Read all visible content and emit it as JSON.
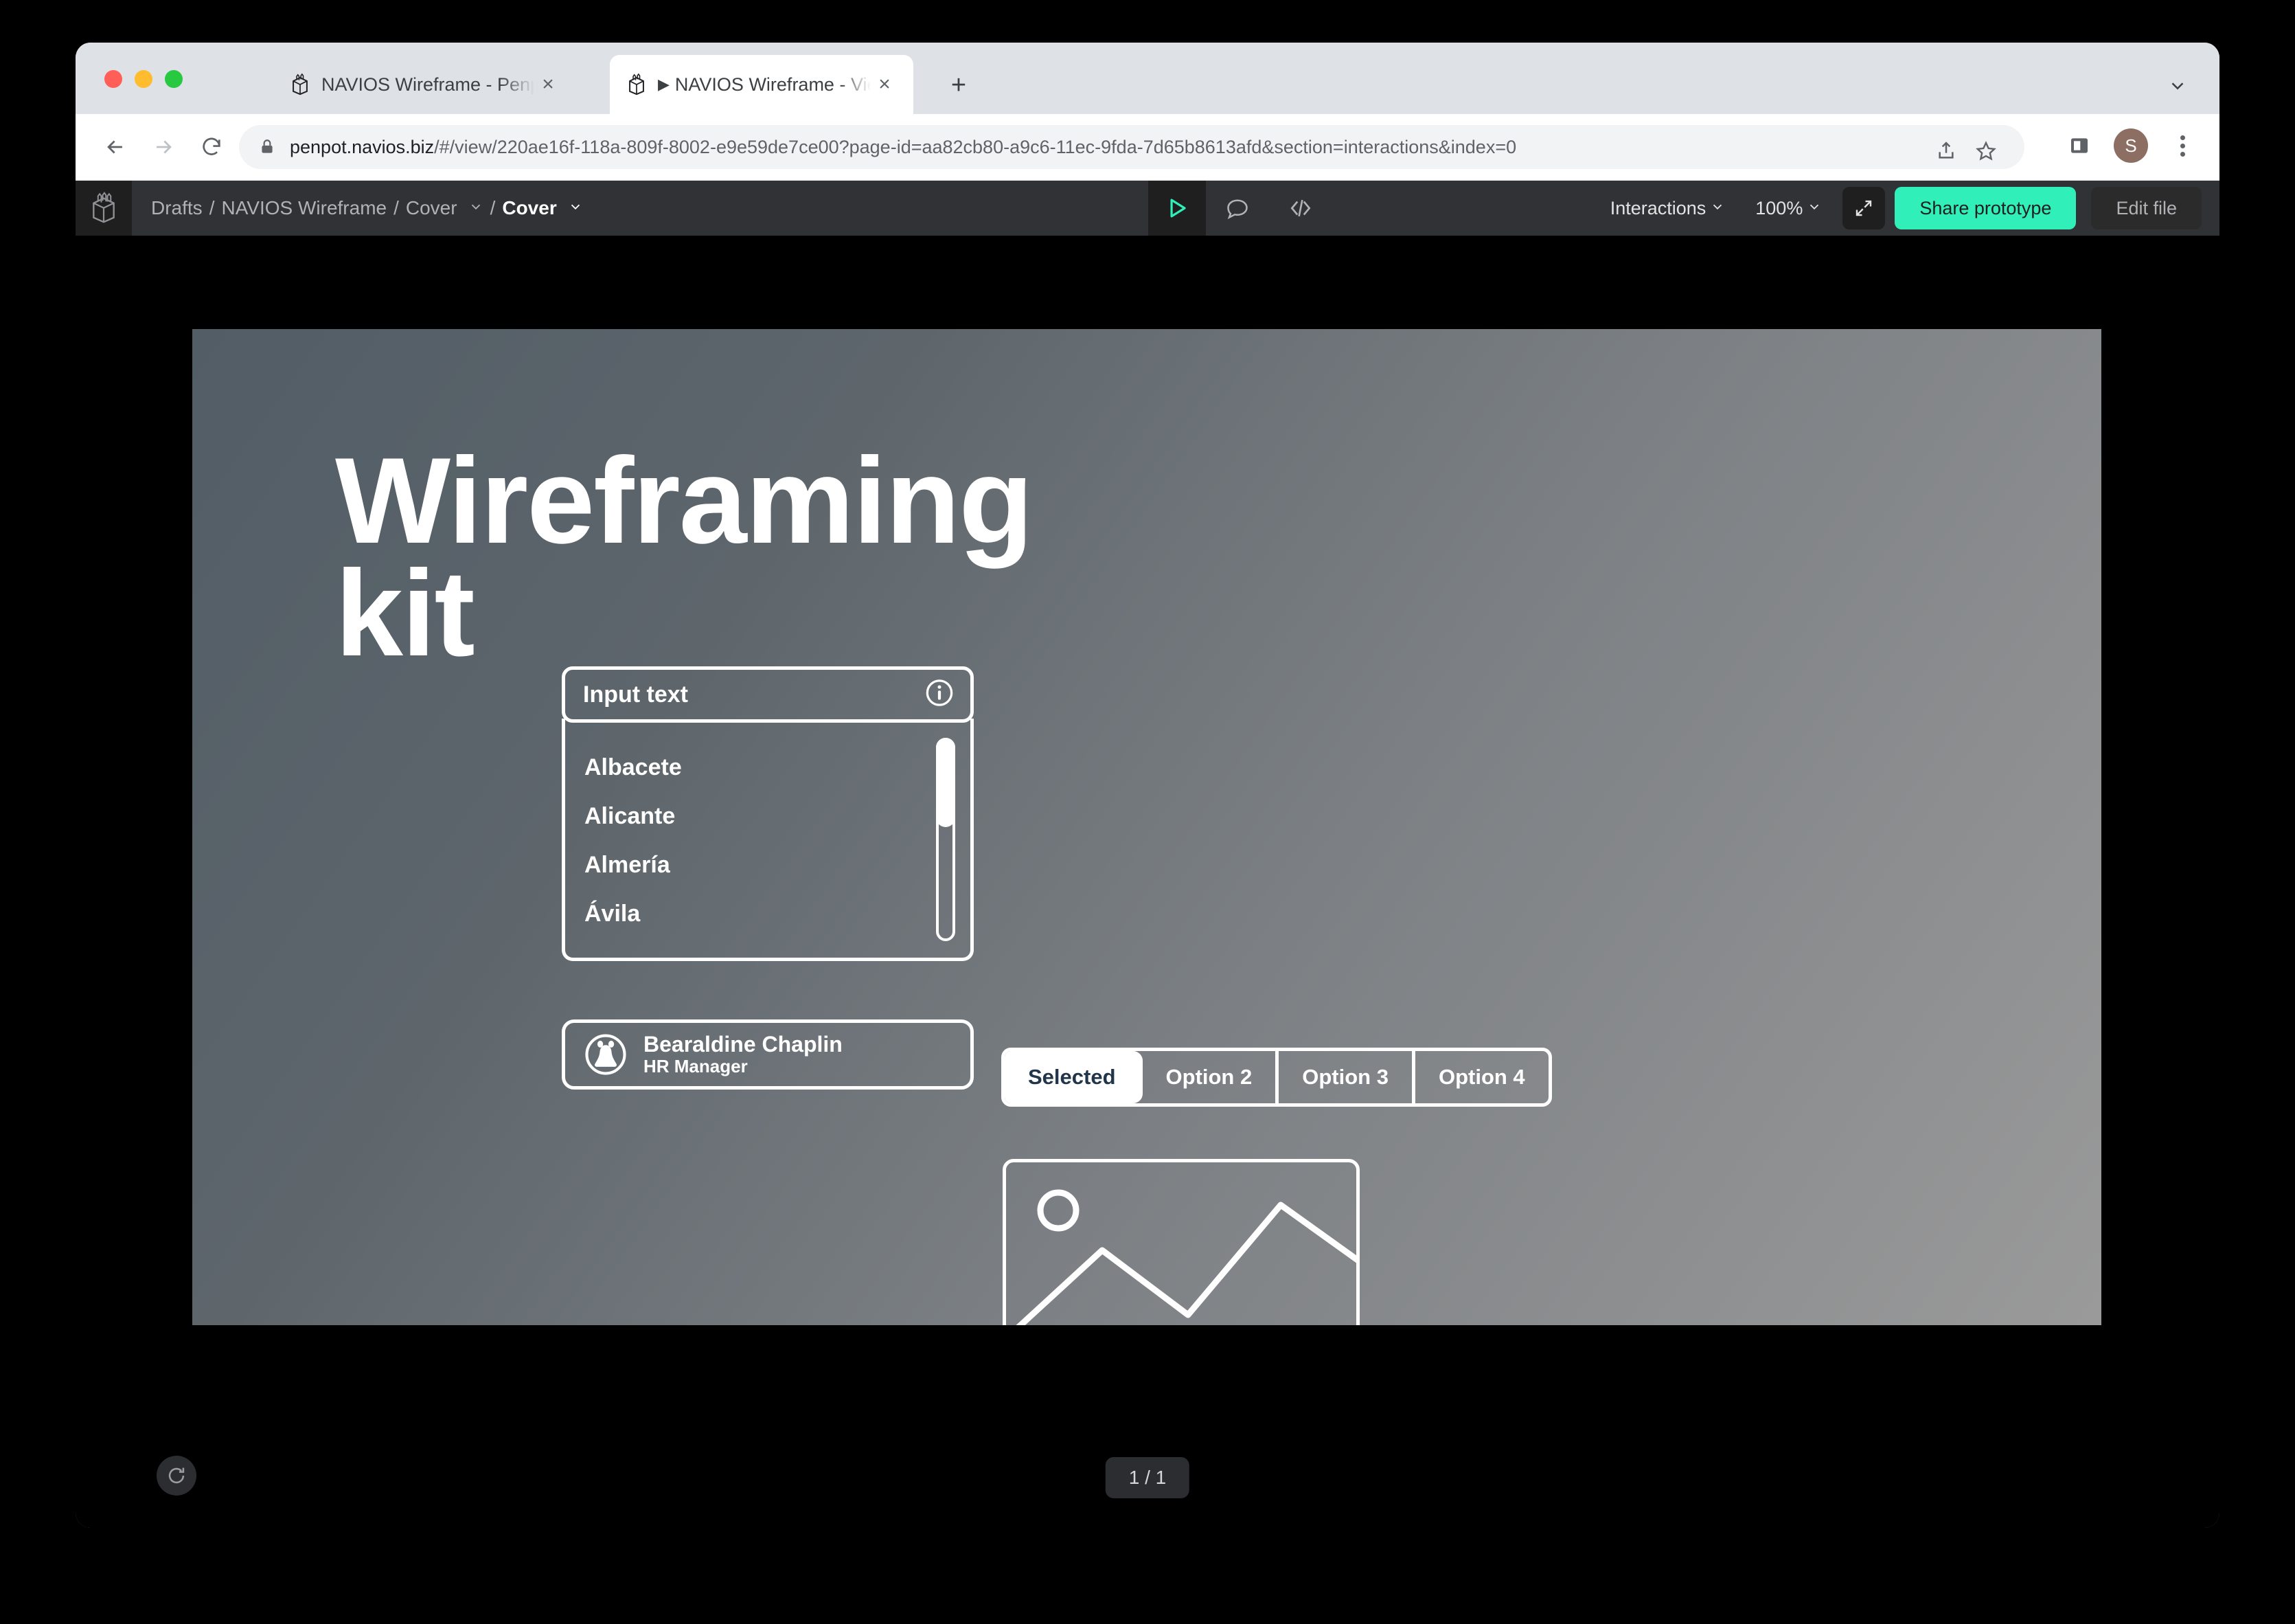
{
  "browser": {
    "tabs": [
      {
        "title": "NAVIOS Wireframe - Penpot",
        "active": false
      },
      {
        "title": "NAVIOS Wireframe - View mo",
        "active": true
      }
    ],
    "new_tab_label": "+",
    "close_label": "×",
    "tab_play_glyph": "▶",
    "url_host": "penpot.navios.biz",
    "url_path": "/#/view/220ae16f-118a-809f-8002-e9e59de7ce00?page-id=aa82cb80-a9c6-11ec-9fda-7d65b8613afd&section=interactions&index=0",
    "profile_initial": "S",
    "icons": {
      "back": "back-arrow-icon",
      "forward": "forward-arrow-icon",
      "reload": "reload-icon",
      "lock": "lock-icon",
      "share": "share-icon",
      "bookmark": "star-icon",
      "sidepanel": "side-panel-icon",
      "menu": "kebab-menu-icon",
      "tabstrip_menu": "chevron-down-icon"
    }
  },
  "penpot": {
    "breadcrumb": {
      "drafts": "Drafts",
      "sep": "/",
      "file": "NAVIOS Wireframe",
      "page": "Cover",
      "board": "Cover"
    },
    "header_icons": {
      "play": "play-icon",
      "comments": "comment-icon",
      "code": "code-icon",
      "fullscreen": "fullscreen-icon"
    },
    "interactions_label": "Interactions",
    "zoom_label": "100%",
    "share_label": "Share prototype",
    "edit_label": "Edit file",
    "page_indicator": "1 / 1",
    "reset_icon": "reset-icon",
    "colors": {
      "accent": "#31efb8",
      "header_bg": "#303236",
      "panel_bg": "#1f1f1f"
    }
  },
  "artboard": {
    "headline_line1": "Wireframing",
    "headline_line2": "kit",
    "dropdown": {
      "input_label": "Input text",
      "info_icon": "info-icon",
      "items": [
        "Albacete",
        "Alicante",
        "Almería",
        "Ávila"
      ]
    },
    "person": {
      "name": "Bearaldine Chaplin",
      "role": "HR Manager",
      "avatar_icon": "bear-avatar-icon"
    },
    "tabs": [
      {
        "label": "Selected",
        "selected": true
      },
      {
        "label": "Option 2",
        "selected": false
      },
      {
        "label": "Option 3",
        "selected": false
      },
      {
        "label": "Option 4",
        "selected": false
      }
    ],
    "image_placeholder_icon": "image-placeholder-icon",
    "colors": {
      "gradient_start": "#525d66",
      "gradient_end": "#9a9a9a",
      "stroke": "#ffffff",
      "selected_tab_text": "#21364a"
    }
  }
}
